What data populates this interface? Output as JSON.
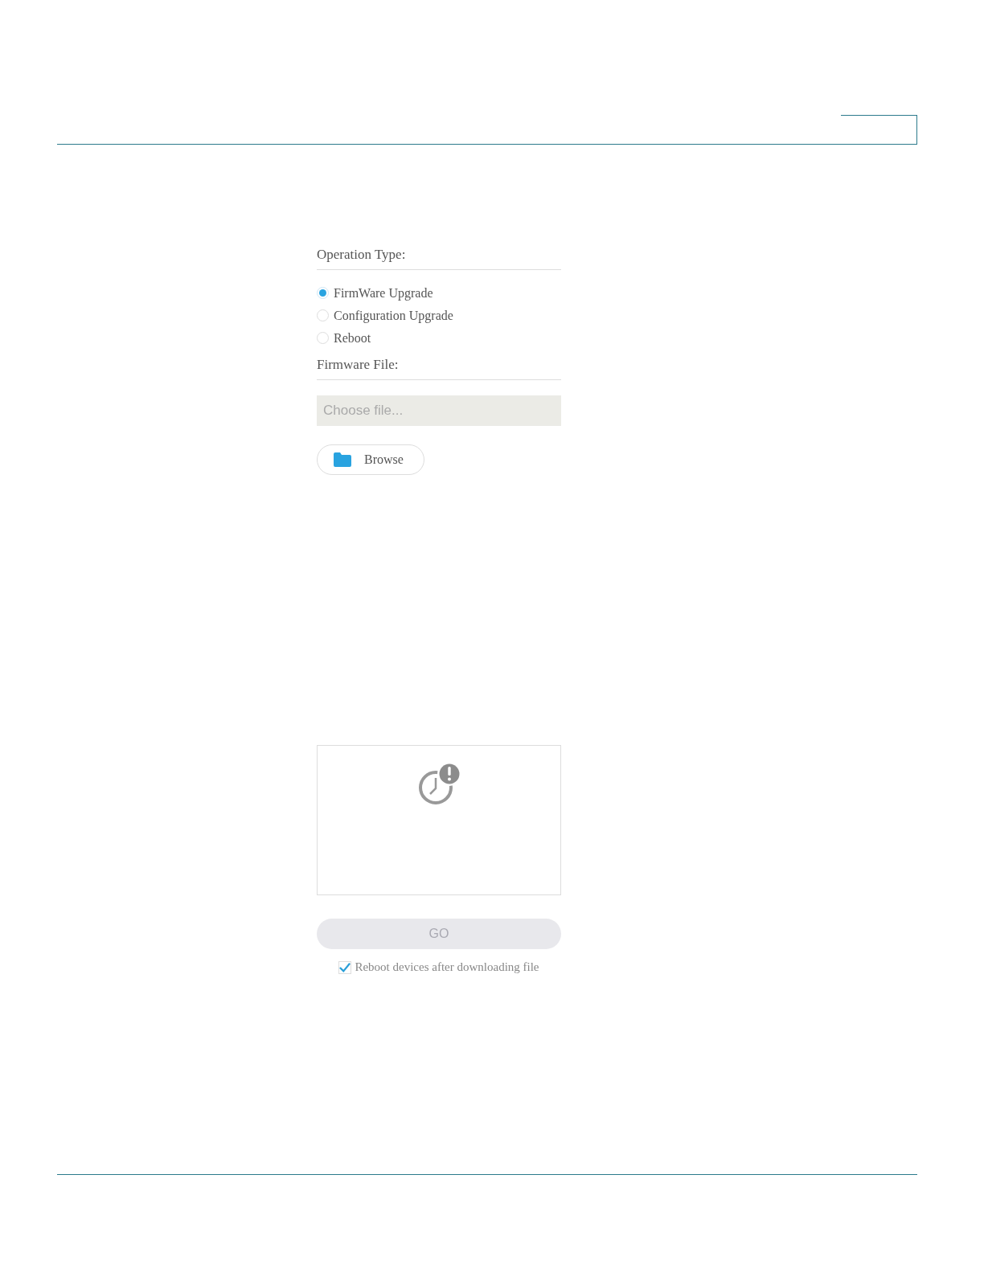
{
  "operation_type": {
    "label": "Operation Type:",
    "options": [
      {
        "label": "FirmWare Upgrade",
        "selected": true
      },
      {
        "label": "Configuration Upgrade",
        "selected": false
      },
      {
        "label": "Reboot",
        "selected": false
      }
    ]
  },
  "firmware_file": {
    "label": "Firmware File:",
    "placeholder": "Choose file..."
  },
  "browse_button": {
    "label": "Browse"
  },
  "go_button": {
    "label": "GO",
    "disabled": true
  },
  "reboot_option": {
    "label": "Reboot devices after downloading file",
    "checked": true
  }
}
